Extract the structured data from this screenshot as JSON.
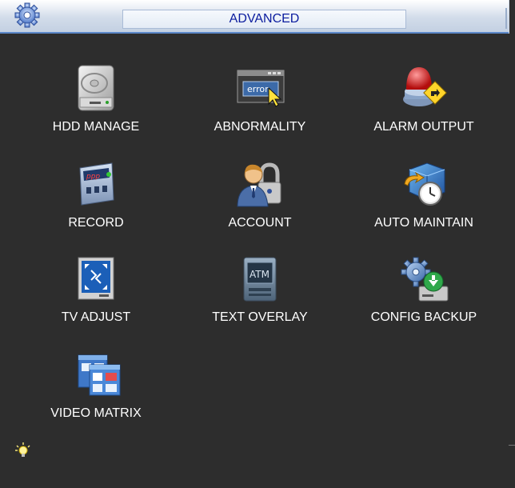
{
  "window": {
    "title": "ADVANCED",
    "title_color": "#0b1c9e",
    "background": "#2d2d2d"
  },
  "menu": {
    "items": [
      {
        "label": "HDD MANAGE",
        "icon": "hard-drive-icon"
      },
      {
        "label": "ABNORMALITY",
        "icon": "error-window-icon"
      },
      {
        "label": "ALARM OUTPUT",
        "icon": "alarm-light-icon"
      },
      {
        "label": "RECORD",
        "icon": "record-icon"
      },
      {
        "label": "ACCOUNT",
        "icon": "user-lock-icon"
      },
      {
        "label": "AUTO MAINTAIN",
        "icon": "clock-maintain-icon"
      },
      {
        "label": "TV ADJUST",
        "icon": "tv-adjust-icon"
      },
      {
        "label": "TEXT OVERLAY",
        "icon": "atm-overlay-icon"
      },
      {
        "label": "CONFIG BACKUP",
        "icon": "gear-backup-icon"
      },
      {
        "label": "VIDEO MATRIX",
        "icon": "video-matrix-icon"
      }
    ]
  },
  "abnormality_icon_text": "error",
  "text_overlay_icon_text": "ATM"
}
